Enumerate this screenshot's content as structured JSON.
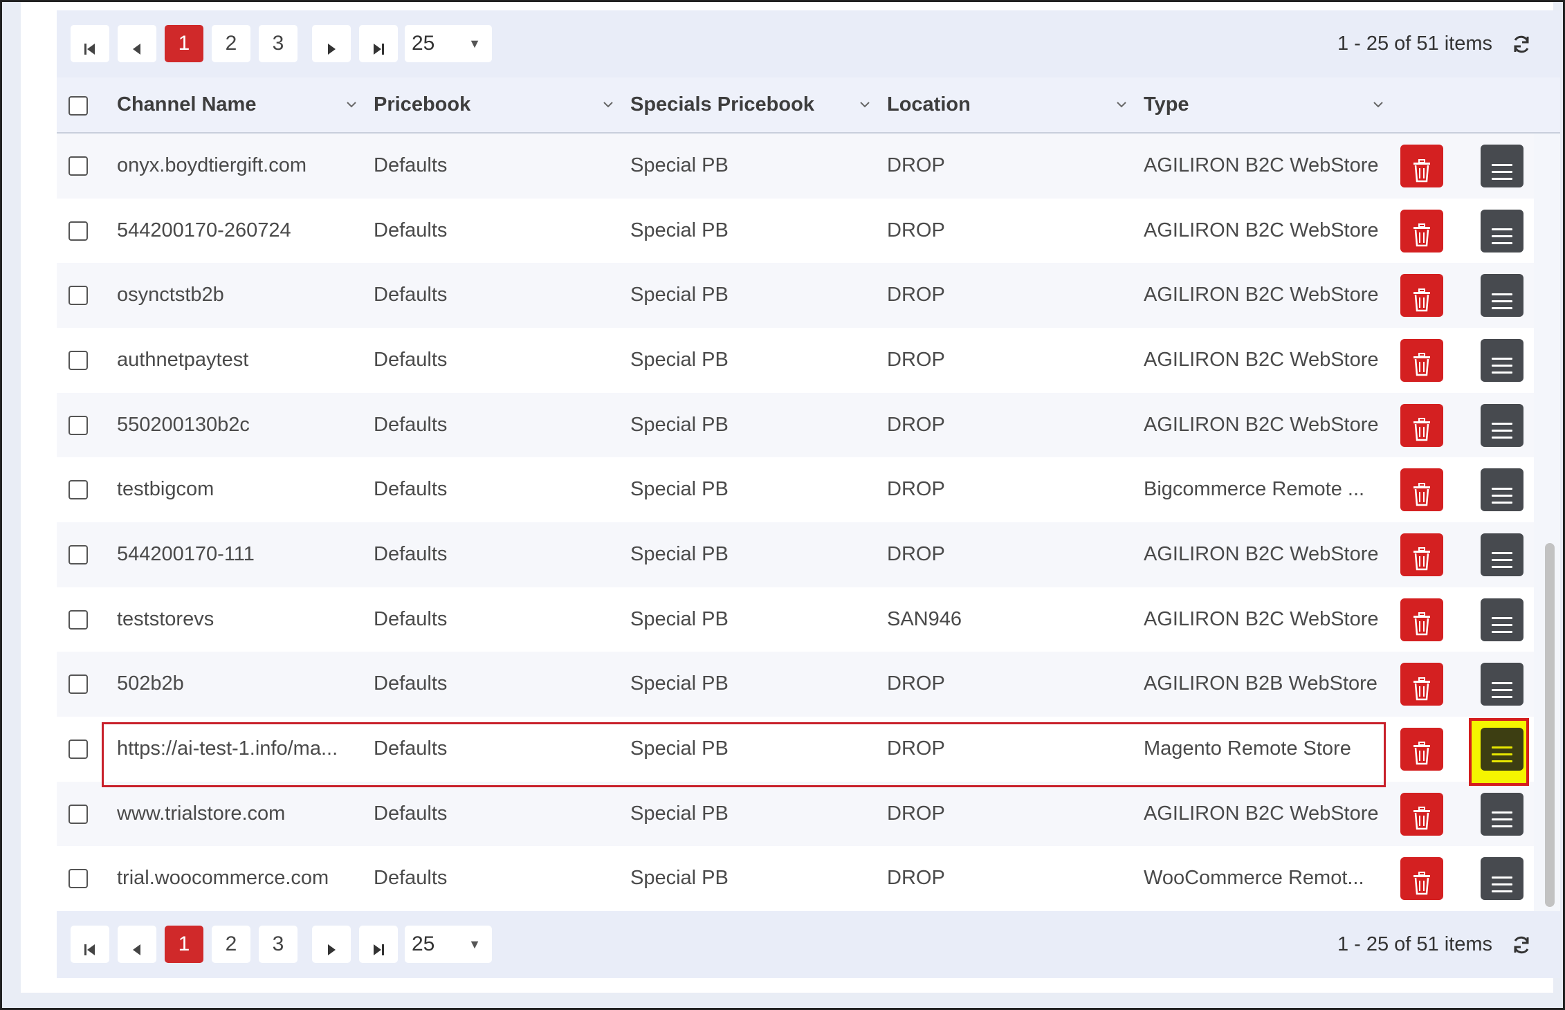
{
  "pager": {
    "first_label": "First page",
    "prev_label": "Previous page",
    "pages": [
      "1",
      "2",
      "3"
    ],
    "current_page": "1",
    "next_label": "Next page",
    "last_label": "Last page",
    "page_size": "25",
    "info": "1 - 25 of 51 items"
  },
  "columns": {
    "channel_name": "Channel Name",
    "pricebook": "Pricebook",
    "specials_pricebook": "Specials Pricebook",
    "location": "Location",
    "type": "Type"
  },
  "rows": [
    {
      "channel": "onyx.boydtiergift.com",
      "pricebook": "Defaults",
      "specials": "Special PB",
      "location": "DROP",
      "type": "AGILIRON B2C WebStore"
    },
    {
      "channel": "544200170-260724",
      "pricebook": "Defaults",
      "specials": "Special PB",
      "location": "DROP",
      "type": "AGILIRON B2C WebStore"
    },
    {
      "channel": "osynctstb2b",
      "pricebook": "Defaults",
      "specials": "Special PB",
      "location": "DROP",
      "type": "AGILIRON B2C WebStore"
    },
    {
      "channel": "authnetpaytest",
      "pricebook": "Defaults",
      "specials": "Special PB",
      "location": "DROP",
      "type": "AGILIRON B2C WebStore"
    },
    {
      "channel": "550200130b2c",
      "pricebook": "Defaults",
      "specials": "Special PB",
      "location": "DROP",
      "type": "AGILIRON B2C WebStore"
    },
    {
      "channel": "testbigcom",
      "pricebook": "Defaults",
      "specials": "Special PB",
      "location": "DROP",
      "type": "Bigcommerce Remote ..."
    },
    {
      "channel": "544200170-111",
      "pricebook": "Defaults",
      "specials": "Special PB",
      "location": "DROP",
      "type": "AGILIRON B2C WebStore"
    },
    {
      "channel": "teststorevs",
      "pricebook": "Defaults",
      "specials": "Special PB",
      "location": "SAN946",
      "type": "AGILIRON B2C WebStore"
    },
    {
      "channel": "502b2b",
      "pricebook": "Defaults",
      "specials": "Special PB",
      "location": "DROP",
      "type": "AGILIRON B2B WebStore"
    },
    {
      "channel": "https://ai-test-1.info/ma...",
      "pricebook": "Defaults",
      "specials": "Special PB",
      "location": "DROP",
      "type": "Magento Remote Store"
    },
    {
      "channel": "www.trialstore.com",
      "pricebook": "Defaults",
      "specials": "Special PB",
      "location": "DROP",
      "type": "AGILIRON B2C WebStore"
    },
    {
      "channel": "trial.woocommerce.com",
      "pricebook": "Defaults",
      "specials": "Special PB",
      "location": "DROP",
      "type": "WooCommerce Remot..."
    }
  ],
  "colors": {
    "delete": "#d42021",
    "menu": "#474a4f",
    "active_page": "#d0292a",
    "highlight": "#f5f500"
  },
  "icons": [
    "first-page-icon",
    "prev-page-icon",
    "next-page-icon",
    "last-page-icon",
    "refresh-icon",
    "sort-chevron-icon",
    "trash-icon",
    "hamburger-menu-icon"
  ]
}
